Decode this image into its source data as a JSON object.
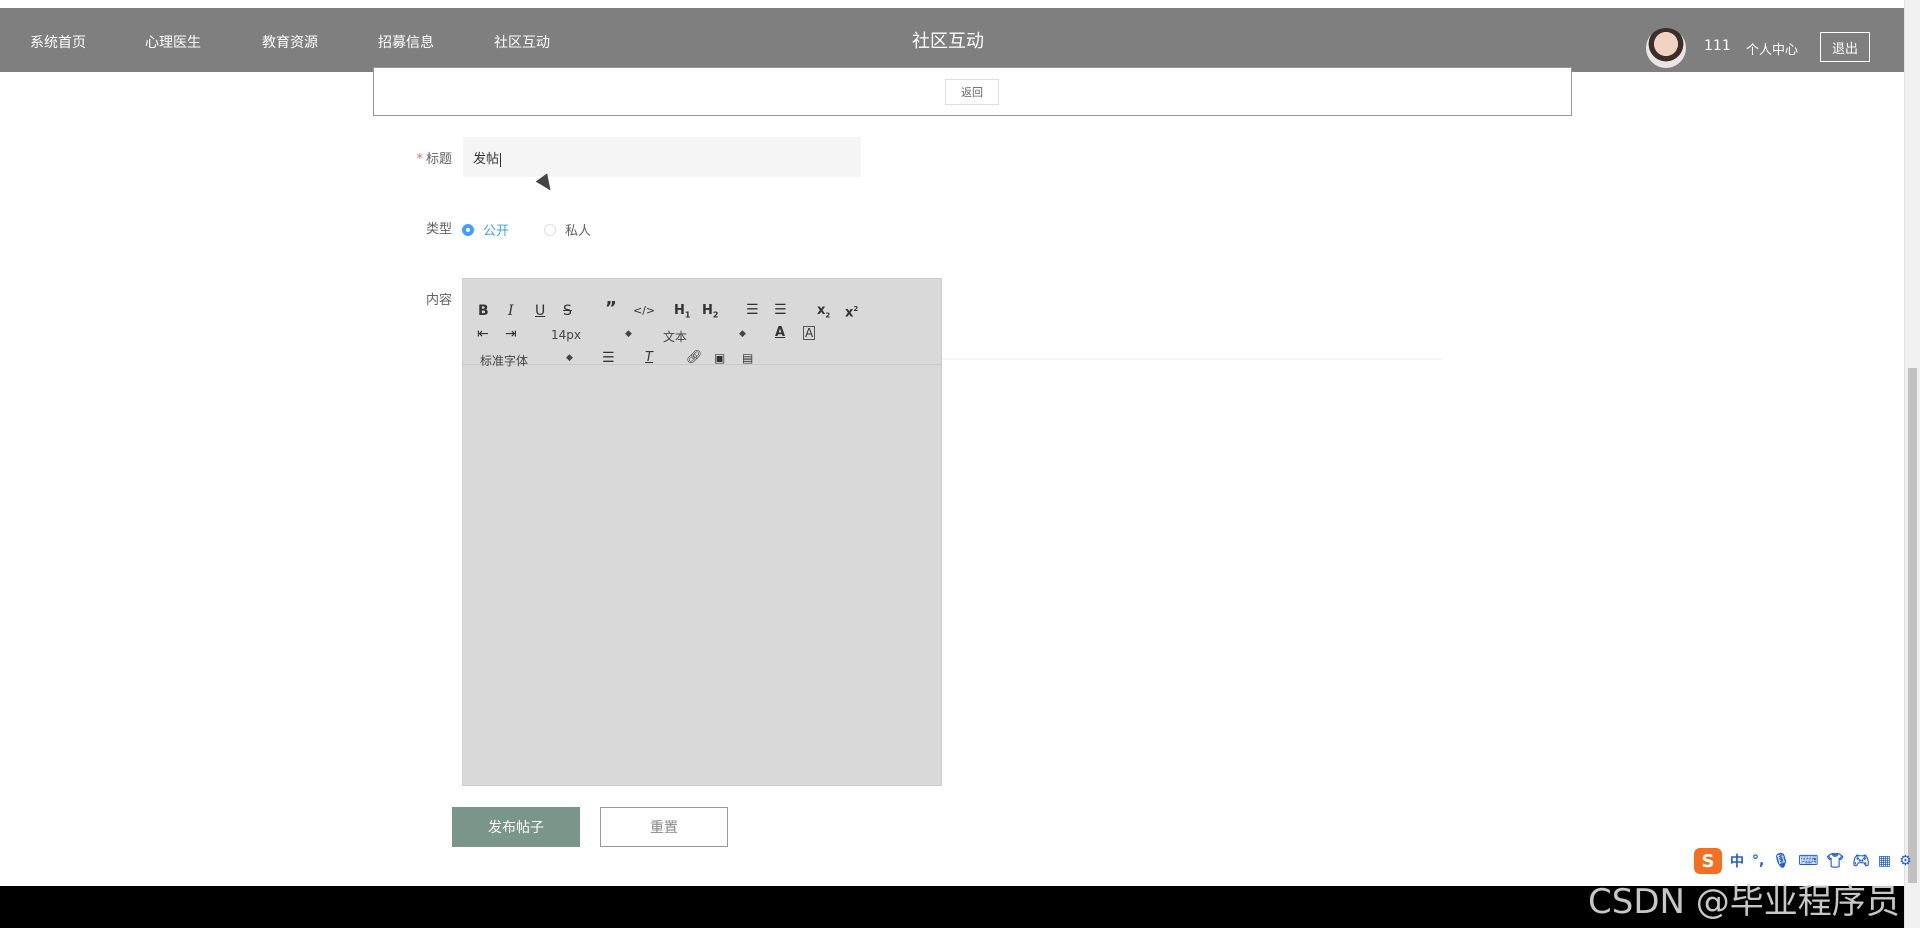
{
  "nav": {
    "items": [
      "系统首页",
      "心理医生",
      "教育资源",
      "招募信息",
      "社区互动"
    ],
    "page_heading": "社区互动",
    "username": "111",
    "profile_label": "个人中心",
    "logout_label": "退出"
  },
  "back_label": "返回",
  "form": {
    "title_label": "标题",
    "title_value": "发帖",
    "type_label": "类型",
    "type_options": [
      "公开",
      "私人"
    ],
    "type_selected": "公开",
    "content_label": "内容",
    "submit_label": "发布帖子",
    "reset_label": "重置"
  },
  "editor": {
    "font_size": "14px",
    "header_select": "文本",
    "font_family": "标准字体"
  },
  "ime": {
    "logo": "S",
    "mode": "中"
  },
  "watermark": "CSDN @毕业程序员"
}
